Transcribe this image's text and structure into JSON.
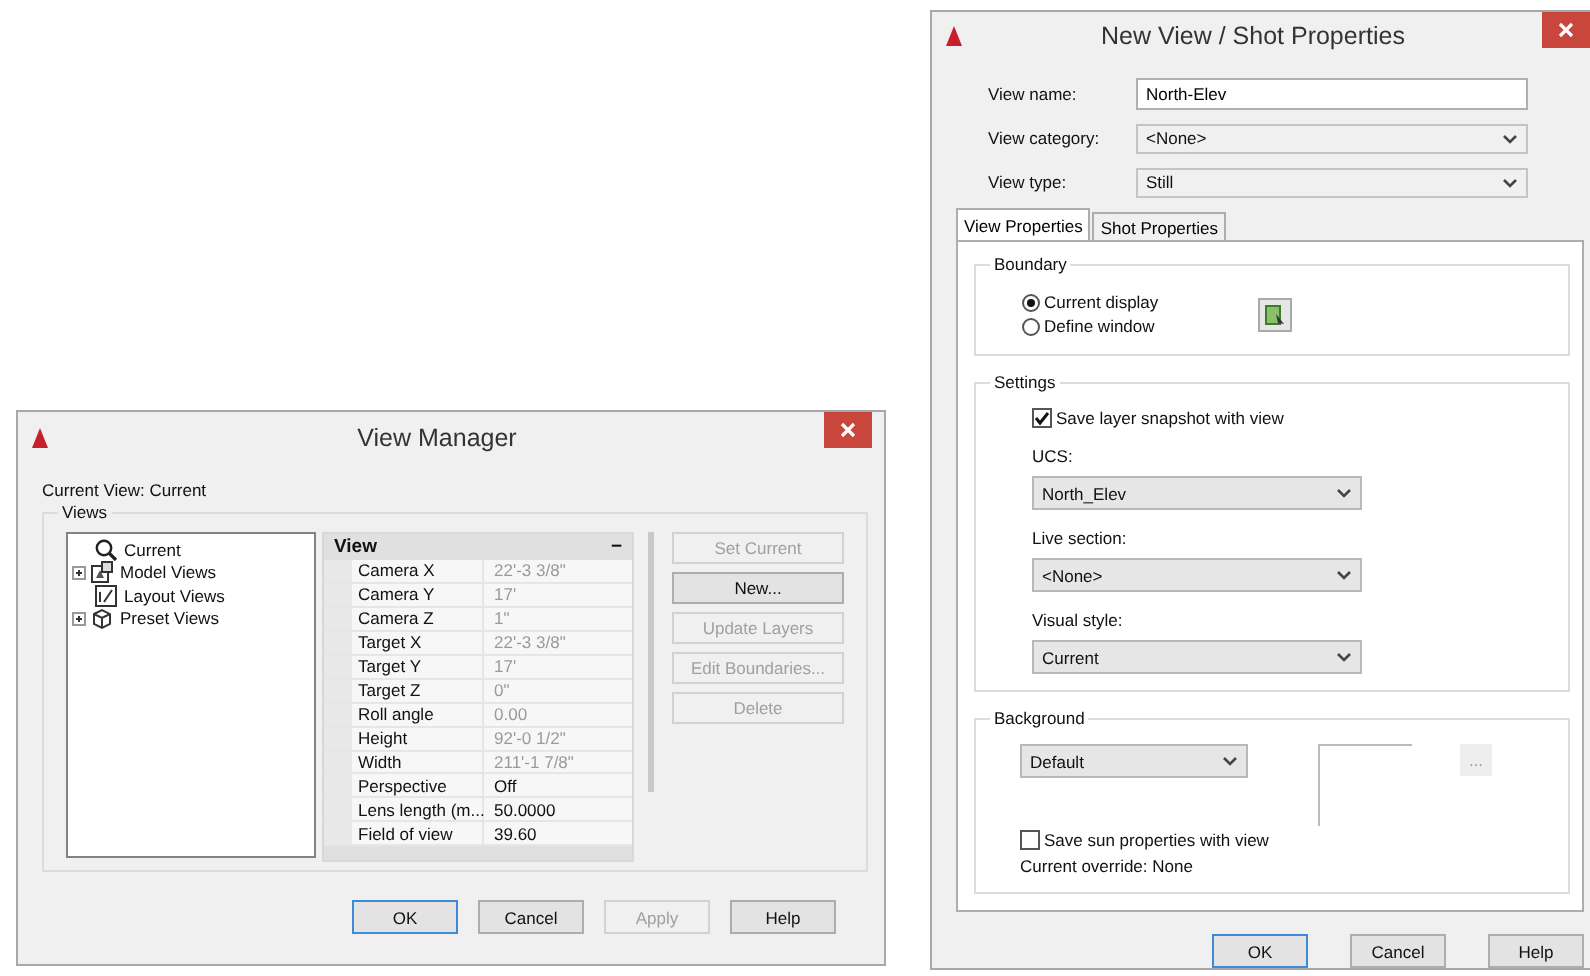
{
  "view_manager": {
    "title": "View Manager",
    "current_view": "Current View: Current",
    "views_label": "Views",
    "tree": [
      {
        "label": "Current",
        "kind": "current",
        "expandable": false
      },
      {
        "label": "Model Views",
        "kind": "model",
        "expandable": true
      },
      {
        "label": "Layout Views",
        "kind": "layout",
        "expandable": false
      },
      {
        "label": "Preset Views",
        "kind": "preset",
        "expandable": true
      }
    ],
    "section": "View",
    "collapse": "−",
    "rows": [
      {
        "name": "Camera X",
        "value": "22'-3 3/8\"",
        "disabled": true
      },
      {
        "name": "Camera Y",
        "value": "17'",
        "disabled": true
      },
      {
        "name": "Camera Z",
        "value": "1\"",
        "disabled": true
      },
      {
        "name": "Target X",
        "value": "22'-3 3/8\"",
        "disabled": true
      },
      {
        "name": "Target Y",
        "value": "17'",
        "disabled": true
      },
      {
        "name": "Target Z",
        "value": "0\"",
        "disabled": true
      },
      {
        "name": "Roll angle",
        "value": "0.00",
        "disabled": true
      },
      {
        "name": "Height",
        "value": "92'-0 1/2\"",
        "disabled": true
      },
      {
        "name": "Width",
        "value": "211'-1 7/8\"",
        "disabled": true
      },
      {
        "name": "Perspective",
        "value": "Off",
        "disabled": false
      },
      {
        "name": "Lens length (m...",
        "value": "50.0000",
        "disabled": false
      },
      {
        "name": "Field of view",
        "value": "39.60",
        "disabled": false
      }
    ],
    "side_buttons": [
      {
        "label": "Set Current",
        "disabled": true
      },
      {
        "label": "New...",
        "disabled": false
      },
      {
        "label": "Update Layers",
        "disabled": true
      },
      {
        "label": "Edit Boundaries...",
        "disabled": true
      },
      {
        "label": "Delete",
        "disabled": true
      }
    ],
    "footer": [
      {
        "label": "OK",
        "default": true,
        "disabled": false
      },
      {
        "label": "Cancel",
        "default": false,
        "disabled": false
      },
      {
        "label": "Apply",
        "default": false,
        "disabled": true
      },
      {
        "label": "Help",
        "default": false,
        "disabled": false
      }
    ]
  },
  "new_view": {
    "title": "New View / Shot Properties",
    "fields": [
      {
        "label": "View name:",
        "kind": "text",
        "value": "North-Elev"
      },
      {
        "label": "View category:",
        "kind": "dropdown",
        "value": "<None>"
      },
      {
        "label": "View type:",
        "kind": "dropdown",
        "value": "Still"
      }
    ],
    "tabs": [
      {
        "label": "View Properties",
        "selected": true
      },
      {
        "label": "Shot Properties",
        "selected": false
      }
    ],
    "boundary": {
      "label": "Boundary",
      "options": [
        {
          "label": "Current display",
          "selected": true
        },
        {
          "label": "Define window",
          "selected": false
        }
      ]
    },
    "settings": {
      "label": "Settings",
      "snapshot": {
        "label": "Save layer snapshot with view",
        "checked": true
      },
      "dropdowns": [
        {
          "label": "UCS:",
          "value": "North_Elev"
        },
        {
          "label": "Live section:",
          "value": "<None>"
        },
        {
          "label": "Visual style:",
          "value": "Current"
        }
      ]
    },
    "background": {
      "label": "Background",
      "value": "Default",
      "browse": "...",
      "sun": {
        "label": "Save sun properties with view",
        "checked": false
      },
      "override": "Current override: None"
    },
    "footer": [
      {
        "label": "OK",
        "default": true,
        "disabled": false
      },
      {
        "label": "Cancel",
        "default": false,
        "disabled": false
      },
      {
        "label": "Help",
        "default": false,
        "disabled": false
      }
    ]
  }
}
